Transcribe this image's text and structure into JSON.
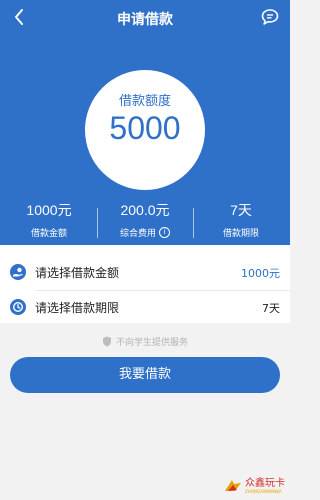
{
  "header": {
    "title": "申请借款"
  },
  "colors": {
    "primary": "#2f70c8",
    "watermark": "#d32d2d"
  },
  "hero": {
    "label": "借款额度",
    "amount": "5000"
  },
  "stats": [
    {
      "value": "1000元",
      "label": "借款金额"
    },
    {
      "value": "200.0元",
      "label": "综合费用",
      "icon": "info-icon"
    },
    {
      "value": "7天",
      "label": "借款期限"
    }
  ],
  "rows": [
    {
      "label": "请选择借款金额",
      "value": "1000元",
      "icon": "coin-hand-icon"
    },
    {
      "label": "请选择借款期限",
      "value": "7天",
      "icon": "clock-icon"
    }
  ],
  "notice": "不向学生提供服务",
  "cta": {
    "label": "我要借款"
  },
  "watermark": {
    "name": "众鑫玩卡",
    "sub": "ZHONGXINWANKA"
  }
}
